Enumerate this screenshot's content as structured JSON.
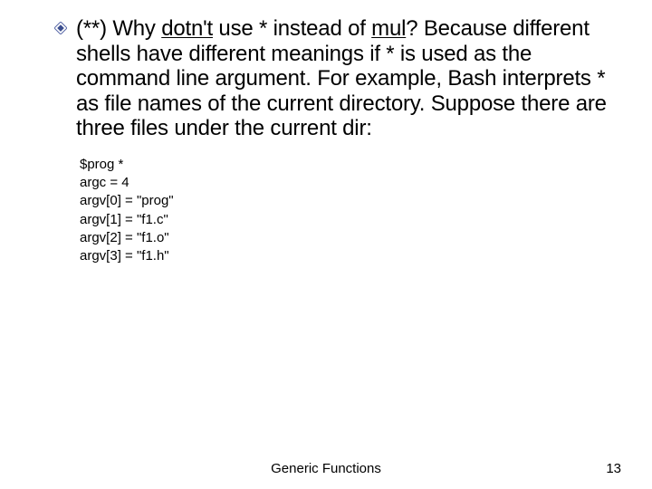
{
  "bullet": {
    "question_prefix": "(**) Why ",
    "question_word": "dotn't",
    "question_mid": " use * instead of ",
    "question_underlined": "mul",
    "question_suffix": "? Because different shells have different meanings if * is used as the command line argument. For example, Bash interprets * as file names of the current directory. Suppose there are three files under the current dir:"
  },
  "code": {
    "lines": [
      "$prog *",
      "argc = 4",
      "argv[0] = \"prog\"",
      "argv[1] = \"f1.c\"",
      "argv[2] = \"f1.o\"",
      "argv[3] = \"f1.h\""
    ]
  },
  "footer": {
    "title": "Generic Functions",
    "page": "13"
  }
}
